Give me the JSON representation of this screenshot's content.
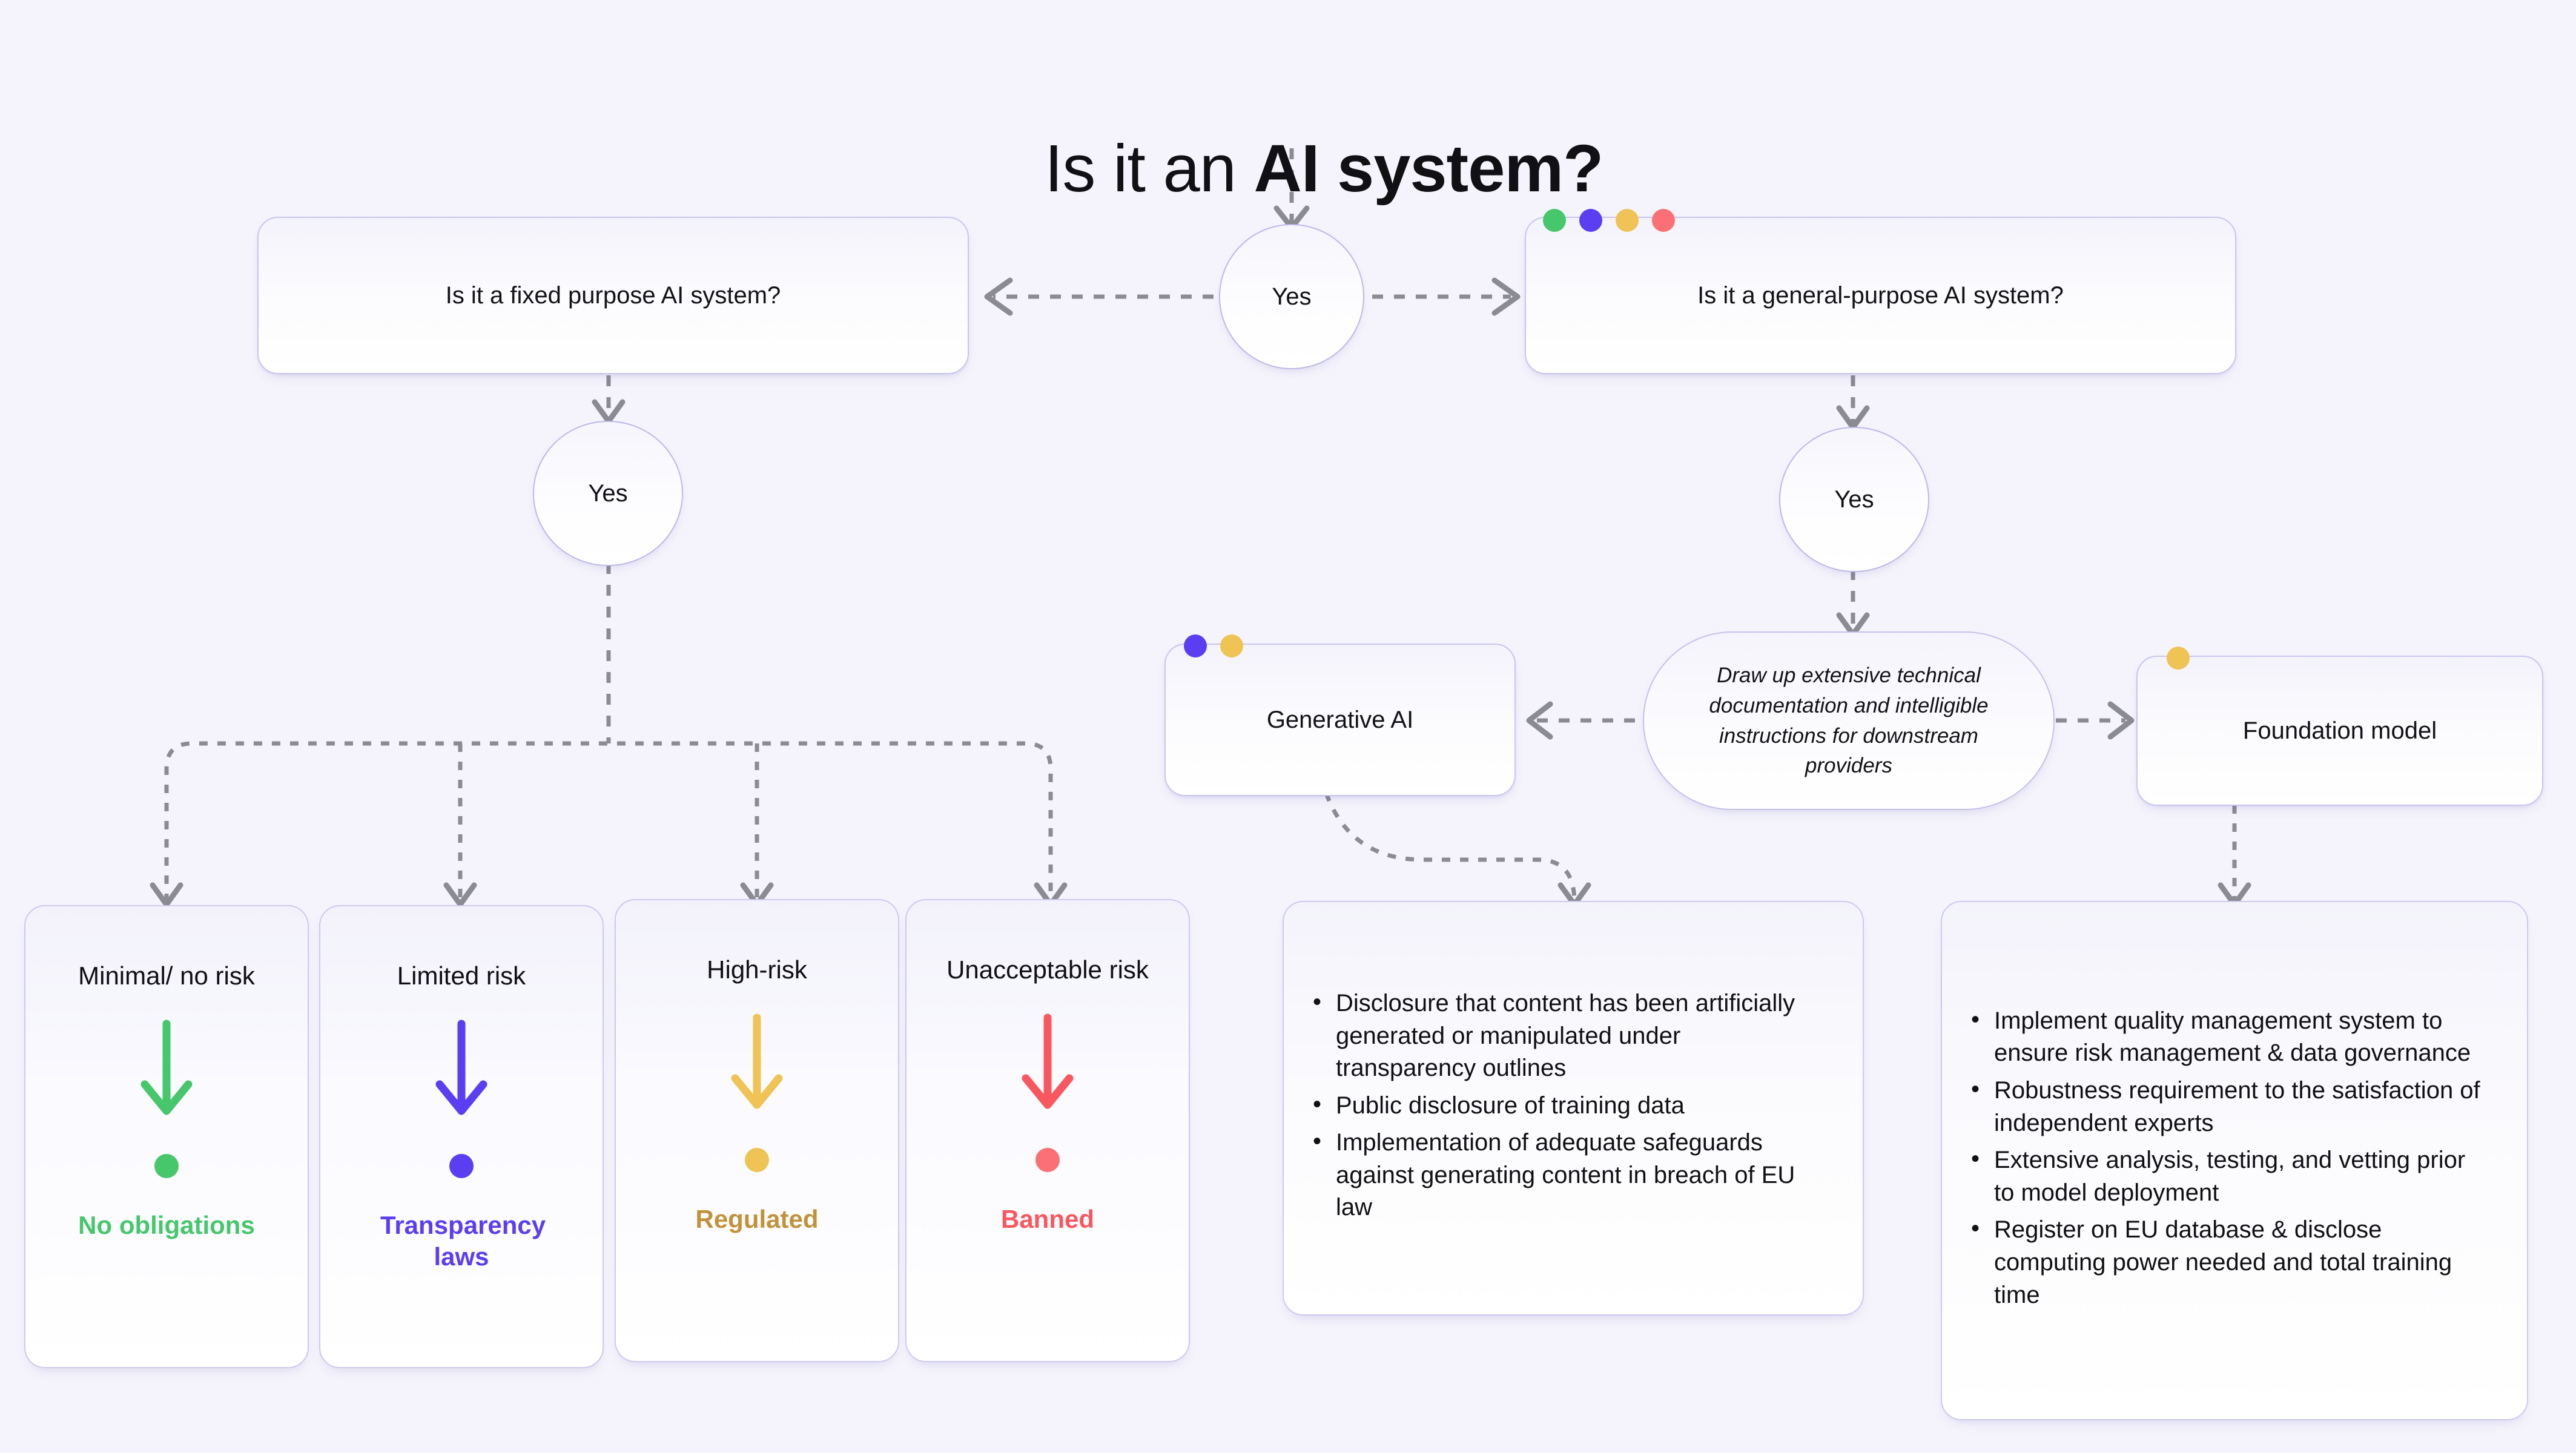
{
  "title": {
    "prefix": "Is it an ",
    "emphasis": "AI system?"
  },
  "colors": {
    "green": "#46c76b",
    "purple": "#5b3df2",
    "amber": "#efc455",
    "red": "#fb7077",
    "regulated_text": "#c2923a",
    "banned_text": "#f9575f",
    "background": "#f5f4fc",
    "node_border": "#c9c6ef",
    "connector": "#8b8b94"
  },
  "decision_yes_top": {
    "label": "Yes"
  },
  "decision_yes_left": {
    "label": "Yes"
  },
  "decision_yes_right": {
    "label": "Yes"
  },
  "nodes": {
    "fixed_purpose": {
      "label": "Is it a fixed purpose AI system?"
    },
    "general_purpose": {
      "label": "Is it a general-purpose AI system?",
      "badges": [
        "green",
        "purple",
        "amber",
        "red"
      ]
    },
    "generative_ai": {
      "label": "Generative AI",
      "badges": [
        "purple",
        "amber"
      ]
    },
    "foundation_model": {
      "label": "Foundation model",
      "badges": [
        "amber"
      ]
    },
    "technical_docs": {
      "label": "Draw up extensive technical documentation and intelligible instructions for downstream providers"
    }
  },
  "risk_cards": [
    {
      "title": "Minimal/ no risk",
      "outcome": "No obligations",
      "color": "#46c76b",
      "arrow_color": "#46c76b"
    },
    {
      "title": "Limited risk",
      "outcome": "Transparency laws",
      "color": "#5b3df2",
      "arrow_color": "#5b3df2"
    },
    {
      "title": "High-risk",
      "outcome": "Regulated",
      "color": "#c2923a",
      "arrow_color": "#efc455"
    },
    {
      "title": "Unacceptable risk",
      "outcome": "Banned",
      "color": "#f9575f",
      "arrow_color": "#f9575f"
    }
  ],
  "generative_ai_obligations": [
    "Disclosure that content has been artificially generated or manipulated under transparency outlines",
    "Public disclosure of training data",
    "Implementation of adequate safeguards against generating content in breach of EU law"
  ],
  "foundation_model_obligations": [
    "Implement quality management system to ensure risk management & data governance",
    "Robustness requirement to the satisfaction of independent experts",
    "Extensive analysis, testing, and vetting prior to model deployment",
    "Register on EU database & disclose computing power needed and total training time"
  ]
}
